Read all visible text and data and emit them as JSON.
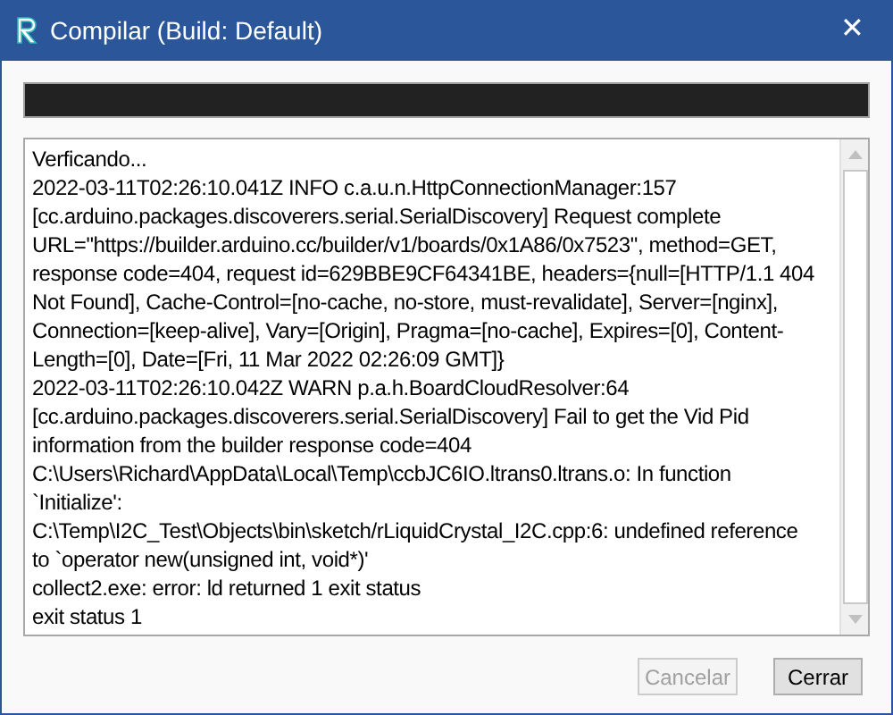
{
  "window": {
    "title": "Compilar (Build: Default)",
    "close": "✕"
  },
  "progress": {
    "level": 1
  },
  "log": {
    "lines": [
      "Verficando...",
      "2022-03-11T02:26:10.041Z INFO c.a.u.n.HttpConnectionManager:157",
      "[cc.arduino.packages.discoverers.serial.SerialDiscovery] Request complete",
      "URL=\"https://builder.arduino.cc/builder/v1/boards/0x1A86/0x7523\", method=GET,",
      "response code=404, request id=629BBE9CF64341BE, headers={null=[HTTP/1.1 404",
      "Not Found], Cache-Control=[no-cache, no-store, must-revalidate], Server=[nginx],",
      "Connection=[keep-alive], Vary=[Origin], Pragma=[no-cache], Expires=[0], Content-",
      "Length=[0], Date=[Fri, 11 Mar 2022 02:26:09 GMT]}",
      "2022-03-11T02:26:10.042Z WARN p.a.h.BoardCloudResolver:64",
      "[cc.arduino.packages.discoverers.serial.SerialDiscovery] Fail to get the Vid Pid",
      "information from the builder response code=404",
      "C:\\Users\\Richard\\AppData\\Local\\Temp\\ccbJC6IO.ltrans0.ltrans.o: In function",
      "`Initialize':",
      "C:\\Temp\\I2C_Test\\Objects\\bin\\sketch/rLiquidCrystal_I2C.cpp:6: undefined reference",
      "to `operator new(unsigned int, void*)'",
      "collect2.exe: error: ld returned 1 exit status",
      "exit status 1"
    ]
  },
  "buttons": [
    {
      "label": "Cancelar",
      "disabled": true
    },
    {
      "label": "Cerrar",
      "disabled": false
    }
  ]
}
